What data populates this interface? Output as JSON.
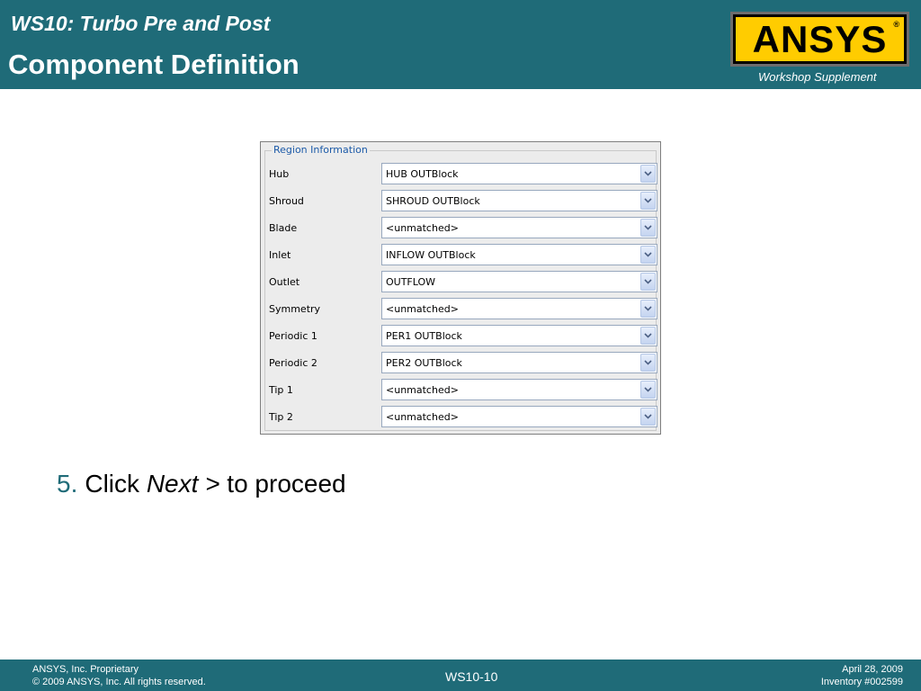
{
  "header": {
    "ws_title": "WS10: Turbo Pre and Post",
    "page_title": "Component Definition",
    "logo_text": "ANSYS",
    "logo_reg": "®",
    "supplement": "Workshop Supplement"
  },
  "panel": {
    "group_title": "Region Information",
    "rows": [
      {
        "label": "Hub",
        "value": "HUB OUTBlock"
      },
      {
        "label": "Shroud",
        "value": "SHROUD OUTBlock"
      },
      {
        "label": "Blade",
        "value": "<unmatched>"
      },
      {
        "label": "Inlet",
        "value": "INFLOW OUTBlock"
      },
      {
        "label": "Outlet",
        "value": "OUTFLOW"
      },
      {
        "label": "Symmetry",
        "value": "<unmatched>"
      },
      {
        "label": "Periodic 1",
        "value": "PER1 OUTBlock"
      },
      {
        "label": "Periodic 2",
        "value": "PER2 OUTBlock"
      },
      {
        "label": "Tip 1",
        "value": "<unmatched>"
      },
      {
        "label": "Tip 2",
        "value": "<unmatched>"
      }
    ]
  },
  "step": {
    "number": "5.",
    "text_before": "Click ",
    "emphasis": "Next >",
    "text_after": " to proceed"
  },
  "footer": {
    "left_line1": "ANSYS, Inc. Proprietary",
    "left_line2": "© 2009 ANSYS, Inc.  All rights reserved.",
    "center": "WS10-10",
    "right_line1": "April 28, 2009",
    "right_line2": "Inventory #002599"
  },
  "colors": {
    "header_bg": "#1f6b78",
    "logo_bg": "#ffcc00",
    "group_title": "#1c5aa8"
  }
}
